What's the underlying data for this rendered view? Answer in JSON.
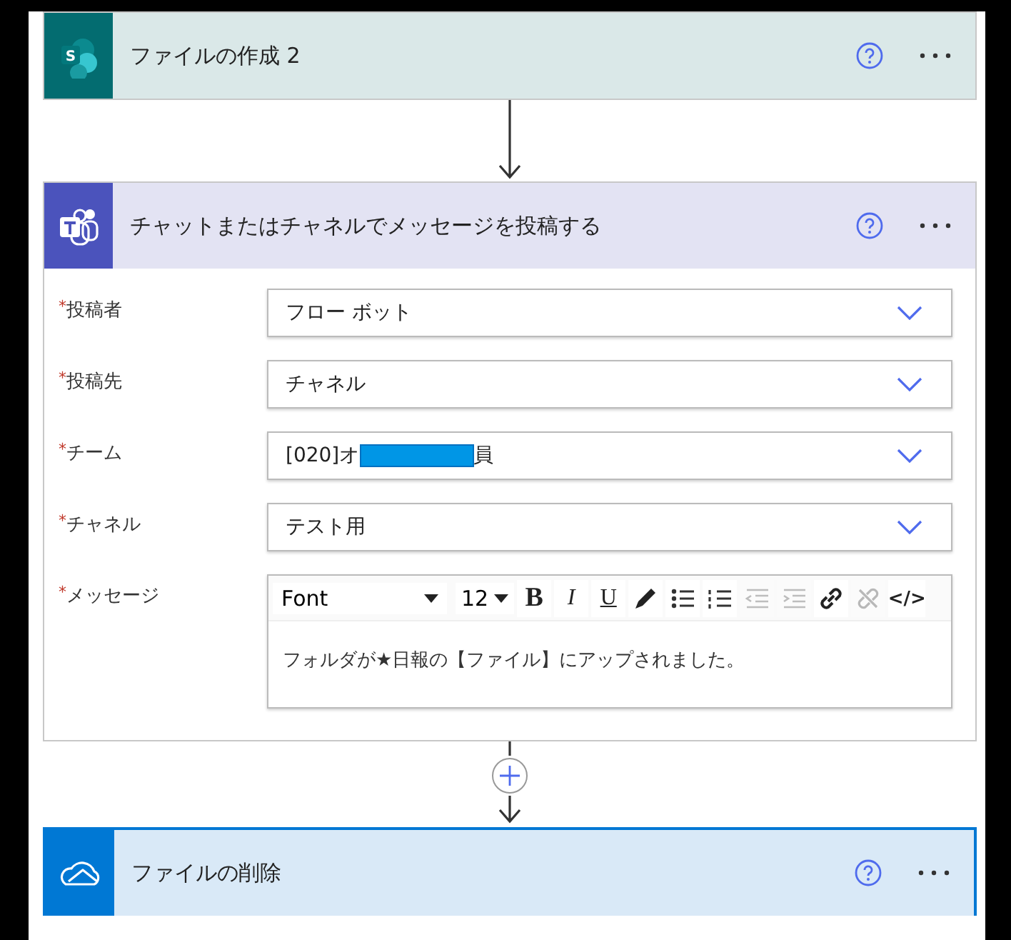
{
  "steps": [
    {
      "kind": "sharepoint",
      "logo_text": "S",
      "title": "ファイルの作成 2",
      "selected": false,
      "connector": {
        "kind": "arrow"
      }
    },
    {
      "kind": "teams",
      "title": "チャットまたはチャネルでメッセージを投稿する",
      "selected": false,
      "connector": {
        "kind": "plus"
      },
      "fields": [
        {
          "kind": "dropdown",
          "required_mark": "*",
          "label": "投稿者",
          "value": "フロー ボット"
        },
        {
          "kind": "dropdown",
          "required_mark": "*",
          "label": "投稿先",
          "value": "チャネル"
        },
        {
          "kind": "dropdown",
          "required_mark": "*",
          "label": "チーム",
          "value": "[020]オ",
          "redacted": true,
          "value_end": "員"
        },
        {
          "kind": "dropdown",
          "required_mark": "*",
          "label": "チャネル",
          "value": "テスト用"
        },
        {
          "kind": "editor",
          "required_mark": "*",
          "label": "メッセージ",
          "font": "Font",
          "size": "12",
          "tools": [
            {
              "kind": "bold",
              "label": "B",
              "disabled": false
            },
            {
              "kind": "italic",
              "label": "I",
              "disabled": false
            },
            {
              "kind": "underline",
              "label": "U",
              "disabled": false
            },
            {
              "kind": "pen",
              "disabled": false
            },
            {
              "kind": "bullets",
              "disabled": false
            },
            {
              "kind": "numbers",
              "disabled": false
            },
            {
              "kind": "outdent",
              "disabled": true
            },
            {
              "kind": "indent",
              "disabled": true
            },
            {
              "kind": "link",
              "disabled": false
            },
            {
              "kind": "unlink",
              "disabled": true
            },
            {
              "kind": "code",
              "label": "</>",
              "disabled": false
            }
          ],
          "value": "フォルダが★日報の【ファイル】にアップされました。"
        }
      ]
    },
    {
      "kind": "onedrive",
      "title": "ファイルの削除",
      "selected": true
    }
  ]
}
